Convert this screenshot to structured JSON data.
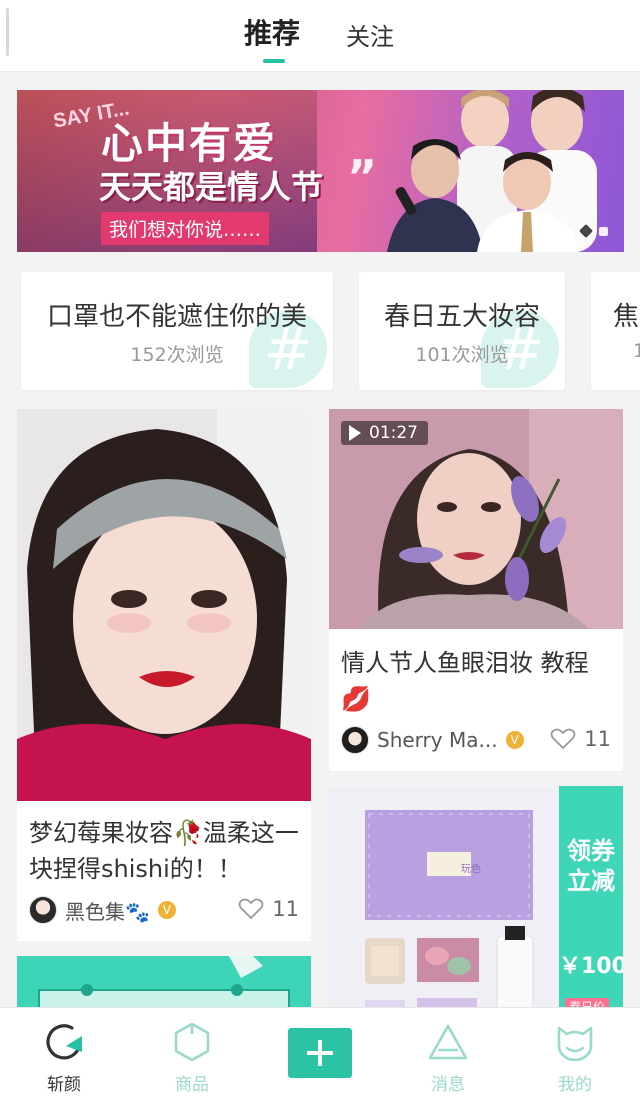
{
  "tabs": {
    "recommend": "推荐",
    "follow": "关注"
  },
  "banner": {
    "say": "SAY IT...",
    "headline": "心中有爱",
    "headline2": "天天都是情人节",
    "quote": "”",
    "subtitle": "我们想对你说……"
  },
  "topics": [
    {
      "title": "口罩也不能遮住你的美",
      "views": "152次浏览"
    },
    {
      "title": "春日五大妆容",
      "views": "101次浏览"
    },
    {
      "title": "焦",
      "views": "1"
    }
  ],
  "feed": {
    "left1": {
      "title": "梦幻莓果妆容🥀温柔这一块捏得shishi的！！",
      "author": "黑色集🐾",
      "likes": "11"
    },
    "right1": {
      "duration": "01:27",
      "title": "情人节人鱼眼泪妆 教程💋",
      "author": "Sherry Ma...",
      "likes": "11"
    },
    "right2": {
      "promo_text": "领券立减",
      "promo_amount": "￥100",
      "box_label": "玩色",
      "tag": "春日价"
    }
  },
  "nav": {
    "items": [
      {
        "label": "斩颜",
        "icon": "refresh-circle-icon"
      },
      {
        "label": "商品",
        "icon": "hexagon-icon"
      },
      {
        "label": "",
        "icon": "plus-icon"
      },
      {
        "label": "消息",
        "icon": "triangle-icon"
      },
      {
        "label": "我的",
        "icon": "cat-face-icon"
      }
    ]
  },
  "colors": {
    "accent": "#26c1a3",
    "accent_light": "#9bd9cc"
  }
}
